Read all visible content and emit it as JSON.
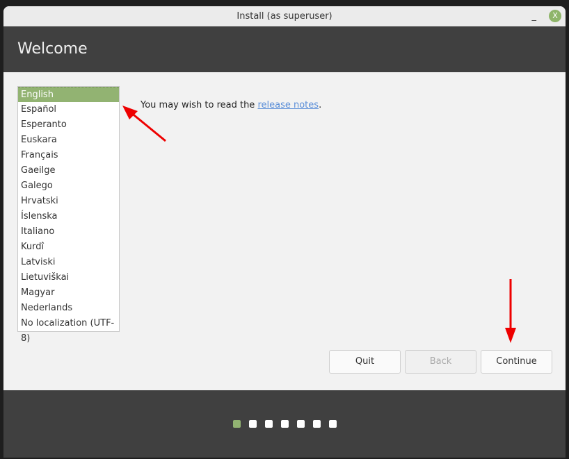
{
  "window": {
    "title": "Install (as superuser)",
    "minimize_label": "_",
    "close_label": "X"
  },
  "header": {
    "title": "Welcome"
  },
  "languages": [
    "English",
    "Español",
    "Esperanto",
    "Euskara",
    "Français",
    "Gaeilge",
    "Galego",
    "Hrvatski",
    "Íslenska",
    "Italiano",
    "Kurdî",
    "Latviski",
    "Lietuviškai",
    "Magyar",
    "Nederlands",
    "No localization (UTF-8)"
  ],
  "selected_language": "English",
  "notes": {
    "prefix": "You may wish to read the ",
    "link": "release notes",
    "suffix": "."
  },
  "buttons": {
    "quit": "Quit",
    "back": "Back",
    "continue": "Continue"
  },
  "progress": {
    "total_steps": 7,
    "current_step": 1
  },
  "colors": {
    "accent": "#92b372",
    "annotation_arrow": "#ee0000"
  }
}
